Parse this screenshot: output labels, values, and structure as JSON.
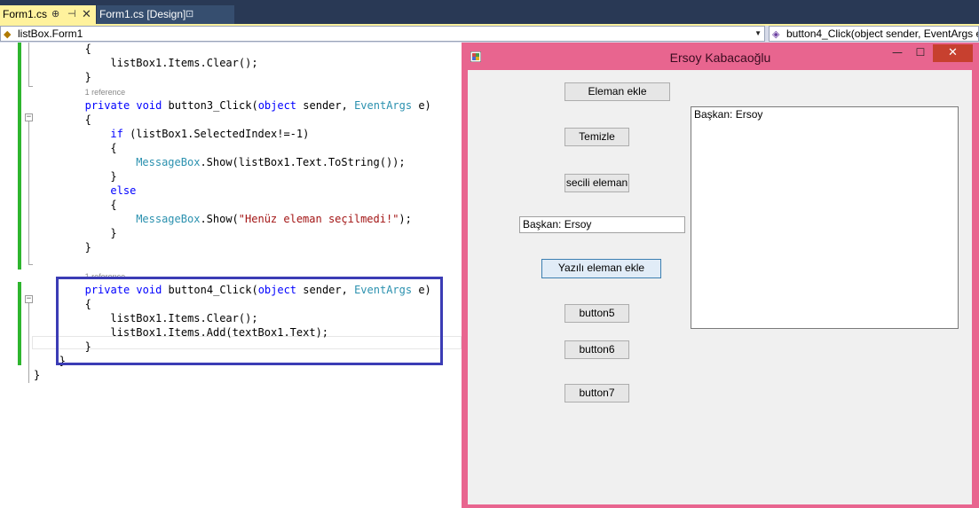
{
  "tabs": {
    "active_label": "Form1.cs",
    "inactive_label": "Form1.cs [Design]"
  },
  "navbar": {
    "class_combo": "listBox.Form1",
    "member_combo": "button4_Click(object sender, EventArgs e)"
  },
  "code": {
    "lines": [
      {
        "indent": 8,
        "tokens": [
          {
            "t": "{"
          }
        ]
      },
      {
        "indent": 12,
        "tokens": [
          {
            "t": "listBox1.Items.Clear();"
          }
        ]
      },
      {
        "indent": 8,
        "tokens": [
          {
            "t": "}"
          }
        ]
      },
      {
        "indent": 8,
        "ref": "1 reference"
      },
      {
        "indent": 8,
        "tokens": [
          {
            "c": "kw",
            "t": "private"
          },
          {
            "t": " "
          },
          {
            "c": "kw",
            "t": "void"
          },
          {
            "t": " button3_Click("
          },
          {
            "c": "kw",
            "t": "object"
          },
          {
            "t": " sender, "
          },
          {
            "c": "ty",
            "t": "EventArgs"
          },
          {
            "t": " e)"
          }
        ]
      },
      {
        "indent": 8,
        "tokens": [
          {
            "t": "{"
          }
        ]
      },
      {
        "indent": 12,
        "tokens": [
          {
            "c": "kw",
            "t": "if"
          },
          {
            "t": " (listBox1.SelectedIndex!=-1)"
          }
        ]
      },
      {
        "indent": 12,
        "tokens": [
          {
            "t": "{"
          }
        ]
      },
      {
        "indent": 16,
        "tokens": [
          {
            "c": "ty",
            "t": "MessageBox"
          },
          {
            "t": ".Show(listBox1.Text.ToString());"
          }
        ]
      },
      {
        "indent": 12,
        "tokens": [
          {
            "t": "}"
          }
        ]
      },
      {
        "indent": 12,
        "tokens": [
          {
            "c": "kw",
            "t": "else"
          }
        ]
      },
      {
        "indent": 12,
        "tokens": [
          {
            "t": "{"
          }
        ]
      },
      {
        "indent": 16,
        "tokens": [
          {
            "c": "ty",
            "t": "MessageBox"
          },
          {
            "t": ".Show("
          },
          {
            "c": "st",
            "t": "\"Henüz eleman seçilmedi!\""
          },
          {
            "t": ");"
          }
        ]
      },
      {
        "indent": 12,
        "tokens": [
          {
            "t": "}"
          }
        ]
      },
      {
        "indent": 8,
        "tokens": [
          {
            "t": "}"
          }
        ]
      },
      {
        "indent": 0,
        "tokens": []
      },
      {
        "indent": 8,
        "ref": "1 reference"
      },
      {
        "indent": 8,
        "tokens": [
          {
            "c": "kw",
            "t": "private"
          },
          {
            "t": " "
          },
          {
            "c": "kw",
            "t": "void"
          },
          {
            "t": " button4_Click("
          },
          {
            "c": "kw",
            "t": "object"
          },
          {
            "t": " sender, "
          },
          {
            "c": "ty",
            "t": "EventArgs"
          },
          {
            "t": " e)"
          }
        ]
      },
      {
        "indent": 8,
        "tokens": [
          {
            "t": "{"
          }
        ]
      },
      {
        "indent": 12,
        "tokens": [
          {
            "t": "listBox1.Items.Clear();"
          }
        ]
      },
      {
        "indent": 12,
        "tokens": [
          {
            "t": "listBox1.Items.Add(textBox1.Text);"
          }
        ]
      },
      {
        "indent": 8,
        "tokens": [
          {
            "t": "}"
          }
        ]
      },
      {
        "indent": 4,
        "tokens": [
          {
            "t": "}"
          }
        ]
      },
      {
        "indent": 0,
        "tokens": [
          {
            "t": "}"
          }
        ]
      }
    ]
  },
  "form": {
    "title": "Ersoy Kabacaoğlu",
    "buttons": {
      "eleman_ekle": "Eleman ekle",
      "temizle": "Temizle",
      "secili_eleman": "secili eleman",
      "yazili_eleman_ekle": "Yazılı eleman ekle",
      "button5": "button5",
      "button6": "button6",
      "button7": "button7"
    },
    "textbox_value": "Başkan: Ersoy",
    "listbox_items": [
      "Başkan: Ersoy"
    ]
  },
  "colors": {
    "form_border": "#e8658f",
    "highlight_box": "#3b3cb5",
    "tab_active": "#fff29d",
    "keyword": "#0000ff",
    "type": "#2b91af",
    "string": "#a31515"
  }
}
